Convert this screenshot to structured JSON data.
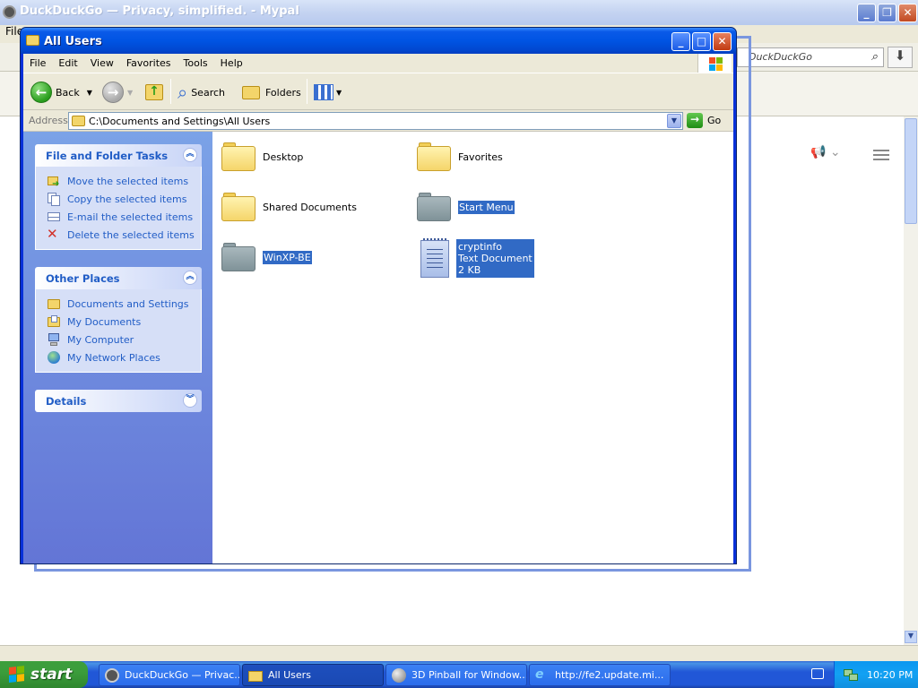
{
  "browser": {
    "title": "DuckDuckGo — Privacy, simplified. - Mypal",
    "menu_first": "File",
    "search_placeholder": "DuckDuckGo"
  },
  "window": {
    "title": "All Users",
    "menu": [
      "File",
      "Edit",
      "View",
      "Favorites",
      "Tools",
      "Help"
    ],
    "toolbar": {
      "back": "Back",
      "search": "Search",
      "folders": "Folders"
    },
    "address": {
      "label": "Address",
      "value": "C:\\Documents and Settings\\All Users",
      "go": "Go"
    }
  },
  "taskpane": {
    "file_tasks": {
      "heading": "File and Folder Tasks",
      "items": [
        "Move the selected items",
        "Copy the selected items",
        "E-mail the selected items",
        "Delete the selected items"
      ]
    },
    "other_places": {
      "heading": "Other Places",
      "items": [
        "Documents and Settings",
        "My Documents",
        "My Computer",
        "My Network Places"
      ]
    },
    "details": {
      "heading": "Details"
    }
  },
  "files": [
    {
      "name": "Desktop",
      "icon": "folder",
      "selected": false
    },
    {
      "name": "Favorites",
      "icon": "folder",
      "selected": false
    },
    {
      "name": "Shared Documents",
      "icon": "folder",
      "selected": false
    },
    {
      "name": "Start Menu",
      "icon": "folder-hidden",
      "selected": true
    },
    {
      "name": "WinXP-BE",
      "icon": "folder-hidden",
      "selected": true
    },
    {
      "name": "cryptinfo",
      "type": "Text Document",
      "size": "2 KB",
      "icon": "text-document",
      "selected": true
    }
  ],
  "taskbar": {
    "start": "start",
    "tasks": [
      "DuckDuckGo — Privac...",
      "All Users",
      "3D Pinball for Window...",
      "http://fe2.update.mi..."
    ],
    "clock": "10:20 PM"
  },
  "colors": {
    "xp_blue": "#0054e3",
    "taskpane_link": "#215dc6",
    "selection": "#316ac5",
    "start_green": "#3b9d3b"
  }
}
